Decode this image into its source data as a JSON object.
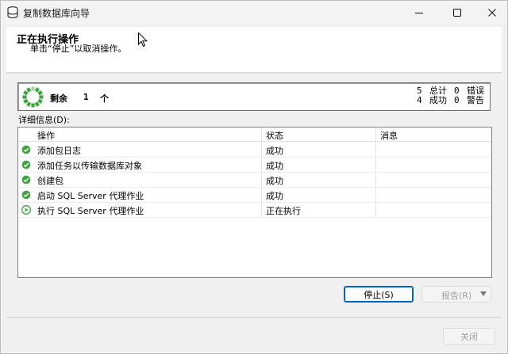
{
  "window": {
    "title": "复制数据库向导",
    "title_icon": "database-icon",
    "controls": {
      "minimize": "minimize-icon",
      "maximize": "maximize-icon",
      "close": "close-icon"
    }
  },
  "header": {
    "title": "正在执行操作",
    "subtitle": "单击“停止”以取消操作。"
  },
  "progress": {
    "remaining_label": "剩余",
    "remaining_count": "1",
    "remaining_unit": "个",
    "total_count": "5",
    "total_label": "总计",
    "error_count": "0",
    "error_label": "错误",
    "success_count": "4",
    "success_label": "成功",
    "warning_count": "0",
    "warning_label": "警告"
  },
  "details": {
    "label": "详细信息(D):",
    "columns": {
      "action": "操作",
      "status": "状态",
      "message": "消息"
    },
    "rows": [
      {
        "action": "添加包日志",
        "status": "成功",
        "message": "",
        "icon": "success-check-icon"
      },
      {
        "action": "添加任务以传输数据库对象",
        "status": "成功",
        "message": "",
        "icon": "success-check-icon"
      },
      {
        "action": "创建包",
        "status": "成功",
        "message": "",
        "icon": "success-check-icon"
      },
      {
        "action": "启动 SQL Server 代理作业",
        "status": "成功",
        "message": "",
        "icon": "success-check-icon"
      },
      {
        "action": "执行 SQL Server 代理作业",
        "status": "正在执行",
        "message": "",
        "icon": "in-progress-icon"
      }
    ]
  },
  "buttons": {
    "stop": "停止(S)",
    "report": "报告(R)",
    "close": "关闭"
  },
  "colors": {
    "success": "#3aa53a",
    "focus_border": "#0067c0",
    "disabled_text": "#a0a0a0"
  }
}
